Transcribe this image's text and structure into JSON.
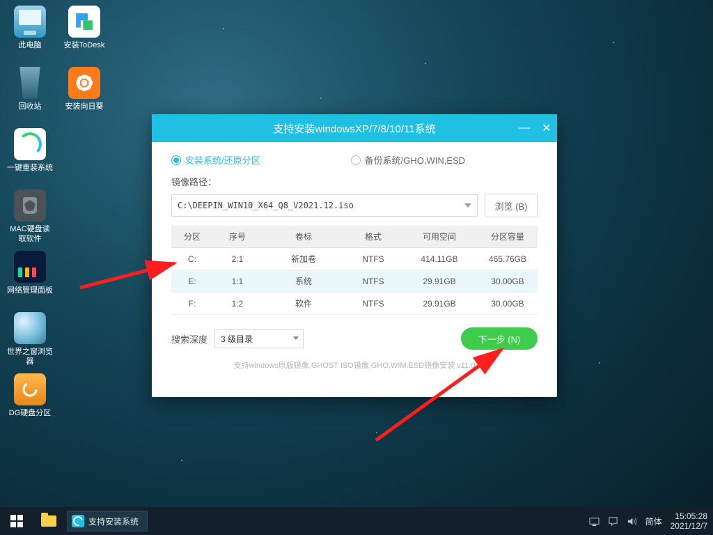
{
  "desktop_icons_col1": [
    {
      "name": "pc",
      "label": "此电脑"
    },
    {
      "name": "recycle",
      "label": "回收站"
    },
    {
      "name": "reinstall",
      "label": "一键重装系统"
    },
    {
      "name": "macread",
      "label": "MAC硬盘读\n取软件"
    },
    {
      "name": "netpanel",
      "label": "网络管理面板"
    },
    {
      "name": "browser",
      "label": "世界之窗浏览\n器"
    },
    {
      "name": "dgpart",
      "label": "DG硬盘分区"
    }
  ],
  "desktop_icons_col2": [
    {
      "name": "todesk",
      "label": "安装ToDesk"
    },
    {
      "name": "sunflower",
      "label": "安装向日葵"
    }
  ],
  "window": {
    "title": "支持安装windowsXP/7/8/10/11系统",
    "mode_install": "安装系统/还原分区",
    "mode_backup": "备份系统/GHO,WIN,ESD",
    "path_label": "镜像路径：",
    "path_value": "C:\\DEEPIN_WIN10_X64_Q8_V2021.12.iso",
    "browse": "浏览 (B)",
    "columns": {
      "part": "分区",
      "index": "序号",
      "volume": "卷标",
      "format": "格式",
      "free": "可用空间",
      "cap": "分区容量"
    },
    "rows": [
      {
        "part": "C:",
        "index": "2:1",
        "volume": "新加卷",
        "format": "NTFS",
        "free": "414.11GB",
        "cap": "465.76GB",
        "sel": false
      },
      {
        "part": "E:",
        "index": "1:1",
        "volume": "系统",
        "format": "NTFS",
        "free": "29.91GB",
        "cap": "30.00GB",
        "sel": true
      },
      {
        "part": "F:",
        "index": "1:2",
        "volume": "软件",
        "format": "NTFS",
        "free": "29.91GB",
        "cap": "30.00GB",
        "sel": false
      }
    ],
    "depth_label": "搜索深度",
    "depth_value": "3 级目录",
    "next": "下一步 (N)",
    "footer": "支持windows原版镜像,GHOST ISO镜像,GHO,WIM,ESD镜像安装 v11.0"
  },
  "taskbar": {
    "active_task": "支持安装系统",
    "ime": "简体",
    "time": "15:05:28",
    "date": "2021/12/7"
  }
}
